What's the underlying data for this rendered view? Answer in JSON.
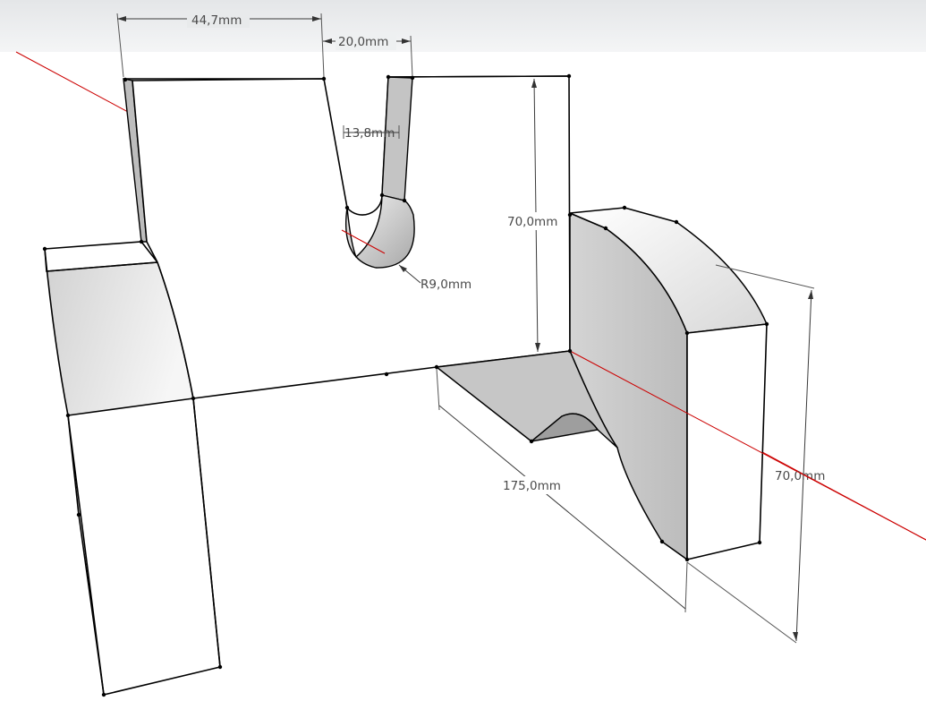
{
  "colors": {
    "sky_top": "#e6e8ea",
    "sky_bottom": "#f7f8f8",
    "ground": "#ffffff",
    "red_axis": "#cc0000",
    "face_shade": "#c8c8c8",
    "dimension_text": "#4a4a4a"
  },
  "dimensions": {
    "d1": "44,7mm",
    "d2": "20,0mm",
    "d3": "13,8mm",
    "d4": "70,0mm",
    "d5": "R9,0mm",
    "d6": "175,0mm",
    "d7": "70,0mm"
  }
}
